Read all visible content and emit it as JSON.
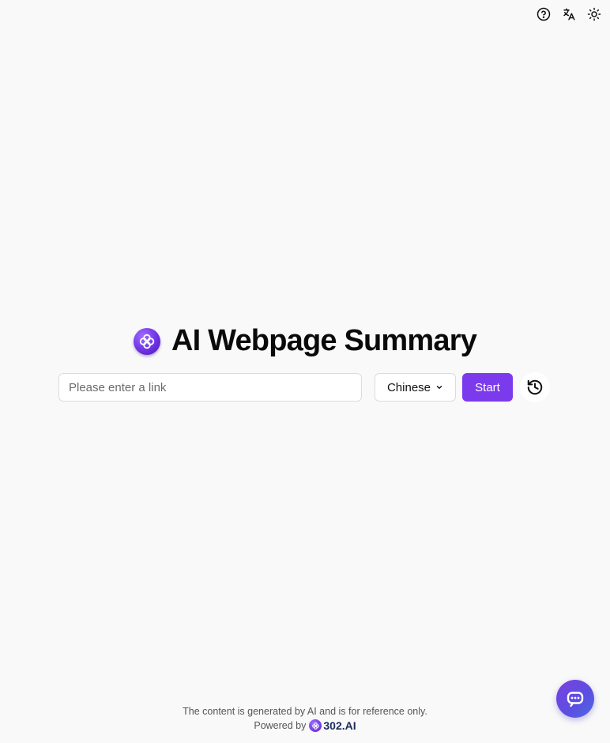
{
  "toolbar": {
    "help_icon": "help-icon",
    "language_icon": "translate-icon",
    "theme_icon": "sun-icon"
  },
  "header": {
    "title": "AI Webpage Summary"
  },
  "form": {
    "link_placeholder": "Please enter a link",
    "link_value": "",
    "language": "Chinese",
    "start_label": "Start"
  },
  "footer": {
    "disclaimer": "The content is generated by AI and is for reference only.",
    "powered_by": "Powered by",
    "brand": "302.AI"
  },
  "colors": {
    "accent": "#7c3aed",
    "background": "#f9f9f9"
  }
}
